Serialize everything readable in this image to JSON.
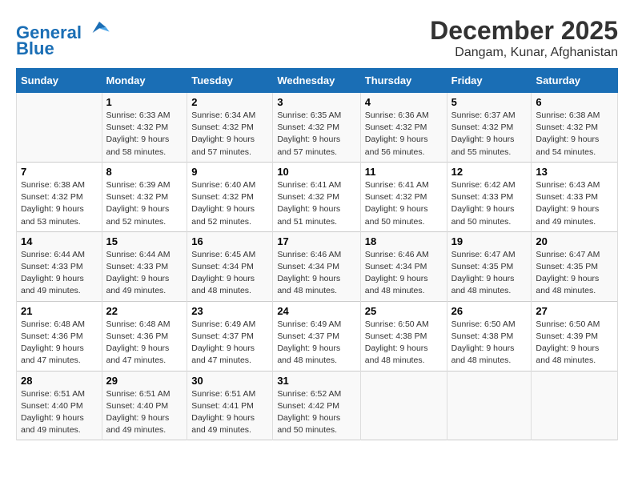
{
  "header": {
    "logo_line1": "General",
    "logo_line2": "Blue",
    "month": "December 2025",
    "location": "Dangam, Kunar, Afghanistan"
  },
  "days_of_week": [
    "Sunday",
    "Monday",
    "Tuesday",
    "Wednesday",
    "Thursday",
    "Friday",
    "Saturday"
  ],
  "weeks": [
    [
      {
        "num": "",
        "info": ""
      },
      {
        "num": "1",
        "info": "Sunrise: 6:33 AM\nSunset: 4:32 PM\nDaylight: 9 hours\nand 58 minutes."
      },
      {
        "num": "2",
        "info": "Sunrise: 6:34 AM\nSunset: 4:32 PM\nDaylight: 9 hours\nand 57 minutes."
      },
      {
        "num": "3",
        "info": "Sunrise: 6:35 AM\nSunset: 4:32 PM\nDaylight: 9 hours\nand 57 minutes."
      },
      {
        "num": "4",
        "info": "Sunrise: 6:36 AM\nSunset: 4:32 PM\nDaylight: 9 hours\nand 56 minutes."
      },
      {
        "num": "5",
        "info": "Sunrise: 6:37 AM\nSunset: 4:32 PM\nDaylight: 9 hours\nand 55 minutes."
      },
      {
        "num": "6",
        "info": "Sunrise: 6:38 AM\nSunset: 4:32 PM\nDaylight: 9 hours\nand 54 minutes."
      }
    ],
    [
      {
        "num": "7",
        "info": "Sunrise: 6:38 AM\nSunset: 4:32 PM\nDaylight: 9 hours\nand 53 minutes."
      },
      {
        "num": "8",
        "info": "Sunrise: 6:39 AM\nSunset: 4:32 PM\nDaylight: 9 hours\nand 52 minutes."
      },
      {
        "num": "9",
        "info": "Sunrise: 6:40 AM\nSunset: 4:32 PM\nDaylight: 9 hours\nand 52 minutes."
      },
      {
        "num": "10",
        "info": "Sunrise: 6:41 AM\nSunset: 4:32 PM\nDaylight: 9 hours\nand 51 minutes."
      },
      {
        "num": "11",
        "info": "Sunrise: 6:41 AM\nSunset: 4:32 PM\nDaylight: 9 hours\nand 50 minutes."
      },
      {
        "num": "12",
        "info": "Sunrise: 6:42 AM\nSunset: 4:33 PM\nDaylight: 9 hours\nand 50 minutes."
      },
      {
        "num": "13",
        "info": "Sunrise: 6:43 AM\nSunset: 4:33 PM\nDaylight: 9 hours\nand 49 minutes."
      }
    ],
    [
      {
        "num": "14",
        "info": "Sunrise: 6:44 AM\nSunset: 4:33 PM\nDaylight: 9 hours\nand 49 minutes."
      },
      {
        "num": "15",
        "info": "Sunrise: 6:44 AM\nSunset: 4:33 PM\nDaylight: 9 hours\nand 49 minutes."
      },
      {
        "num": "16",
        "info": "Sunrise: 6:45 AM\nSunset: 4:34 PM\nDaylight: 9 hours\nand 48 minutes."
      },
      {
        "num": "17",
        "info": "Sunrise: 6:46 AM\nSunset: 4:34 PM\nDaylight: 9 hours\nand 48 minutes."
      },
      {
        "num": "18",
        "info": "Sunrise: 6:46 AM\nSunset: 4:34 PM\nDaylight: 9 hours\nand 48 minutes."
      },
      {
        "num": "19",
        "info": "Sunrise: 6:47 AM\nSunset: 4:35 PM\nDaylight: 9 hours\nand 48 minutes."
      },
      {
        "num": "20",
        "info": "Sunrise: 6:47 AM\nSunset: 4:35 PM\nDaylight: 9 hours\nand 48 minutes."
      }
    ],
    [
      {
        "num": "21",
        "info": "Sunrise: 6:48 AM\nSunset: 4:36 PM\nDaylight: 9 hours\nand 47 minutes."
      },
      {
        "num": "22",
        "info": "Sunrise: 6:48 AM\nSunset: 4:36 PM\nDaylight: 9 hours\nand 47 minutes."
      },
      {
        "num": "23",
        "info": "Sunrise: 6:49 AM\nSunset: 4:37 PM\nDaylight: 9 hours\nand 47 minutes."
      },
      {
        "num": "24",
        "info": "Sunrise: 6:49 AM\nSunset: 4:37 PM\nDaylight: 9 hours\nand 48 minutes."
      },
      {
        "num": "25",
        "info": "Sunrise: 6:50 AM\nSunset: 4:38 PM\nDaylight: 9 hours\nand 48 minutes."
      },
      {
        "num": "26",
        "info": "Sunrise: 6:50 AM\nSunset: 4:38 PM\nDaylight: 9 hours\nand 48 minutes."
      },
      {
        "num": "27",
        "info": "Sunrise: 6:50 AM\nSunset: 4:39 PM\nDaylight: 9 hours\nand 48 minutes."
      }
    ],
    [
      {
        "num": "28",
        "info": "Sunrise: 6:51 AM\nSunset: 4:40 PM\nDaylight: 9 hours\nand 49 minutes."
      },
      {
        "num": "29",
        "info": "Sunrise: 6:51 AM\nSunset: 4:40 PM\nDaylight: 9 hours\nand 49 minutes."
      },
      {
        "num": "30",
        "info": "Sunrise: 6:51 AM\nSunset: 4:41 PM\nDaylight: 9 hours\nand 49 minutes."
      },
      {
        "num": "31",
        "info": "Sunrise: 6:52 AM\nSunset: 4:42 PM\nDaylight: 9 hours\nand 50 minutes."
      },
      {
        "num": "",
        "info": ""
      },
      {
        "num": "",
        "info": ""
      },
      {
        "num": "",
        "info": ""
      }
    ]
  ]
}
